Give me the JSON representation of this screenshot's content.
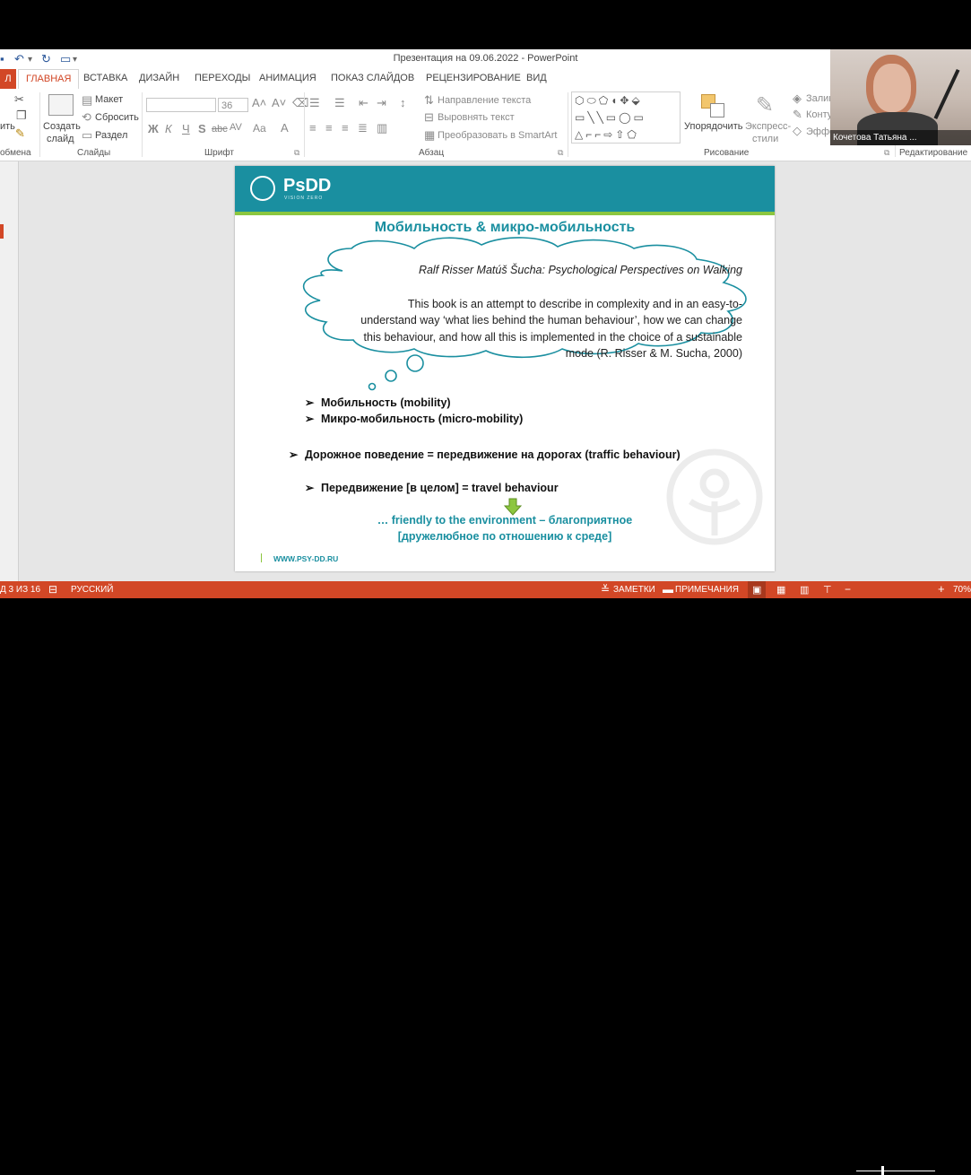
{
  "window": {
    "title": "Презентация на 09.06.2022 - PowerPoint"
  },
  "tabs": [
    {
      "label": "Л"
    },
    {
      "label": "ГЛАВНАЯ"
    },
    {
      "label": "ВСТАВКА"
    },
    {
      "label": "ДИЗАЙН"
    },
    {
      "label": "ПЕРЕХОДЫ"
    },
    {
      "label": "АНИМАЦИЯ"
    },
    {
      "label": "ПОКАЗ СЛАЙДОВ"
    },
    {
      "label": "РЕЦЕНЗИРОВАНИЕ"
    },
    {
      "label": "ВИД"
    }
  ],
  "ribbon": {
    "clipboard": {
      "paste_label": "ить",
      "group_label": "обмена"
    },
    "slides": {
      "new_slide_line1": "Создать",
      "new_slide_line2": "слайд",
      "layout": "Макет",
      "reset": "Сбросить",
      "section": "Раздел",
      "group_label": "Слайды"
    },
    "font": {
      "size": "36",
      "bold": "Ж",
      "italic": "К",
      "underline": "Ч",
      "shadow": "S",
      "strike": "abc",
      "spacing": "AV",
      "case": "Aa",
      "group_label": "Шрифт"
    },
    "paragraph": {
      "text_direction": "Направление текста",
      "align_text": "Выровнять текст",
      "smartart": "Преобразовать в SmartArt",
      "group_label": "Абзац"
    },
    "drawing": {
      "arrange": "Упорядочить",
      "quick_styles_line1": "Экспресс-",
      "quick_styles_line2": "стили",
      "fill": "Залив",
      "outline": "Конту",
      "effects": "Эффе",
      "group_label": "Рисование"
    },
    "editing": {
      "group_label": "Редактирование"
    }
  },
  "slide": {
    "logo": "PsDD",
    "logo_sub": "VISION ZERO",
    "title": "Мобильность & микро-мобильность",
    "quote_author": "Ralf Risser Matúš Šucha: Psychological Perspectives on Walking",
    "quote_lines": [
      "This book is an attempt to describe in complexity and in an easy-to-",
      "understand way ‘what lies behind the human behaviour’, how we can change",
      "this behaviour, and how all this is implemented in the choice of a sustainable",
      "mode (R. Risser & M. Sucha, 2000)"
    ],
    "bullets": [
      "Мобильность (mobility)",
      "Микро-мобильность (micro-mobility)",
      "Дорожное поведение = передвижение на дорогах (traffic behaviour)",
      "Передвижение [в целом] = travel behaviour"
    ],
    "friendly_line1": "… friendly to the environment – благоприятное",
    "friendly_line2": "[дружелюбное по отношению к среде]",
    "footer_url": "WWW.PSY-DD.RU"
  },
  "statusbar": {
    "slide_counter": "Д 3 ИЗ 16",
    "language": "РУССКИЙ",
    "notes": "ЗАМЕТКИ",
    "comments": "ПРИМЕЧАНИЯ",
    "zoom": "70%"
  },
  "webcam": {
    "name": "Кочетова Татьяна ..."
  },
  "colors": {
    "accent": "#d24726",
    "teal": "#1a8fa0",
    "green": "#8cc63f"
  }
}
